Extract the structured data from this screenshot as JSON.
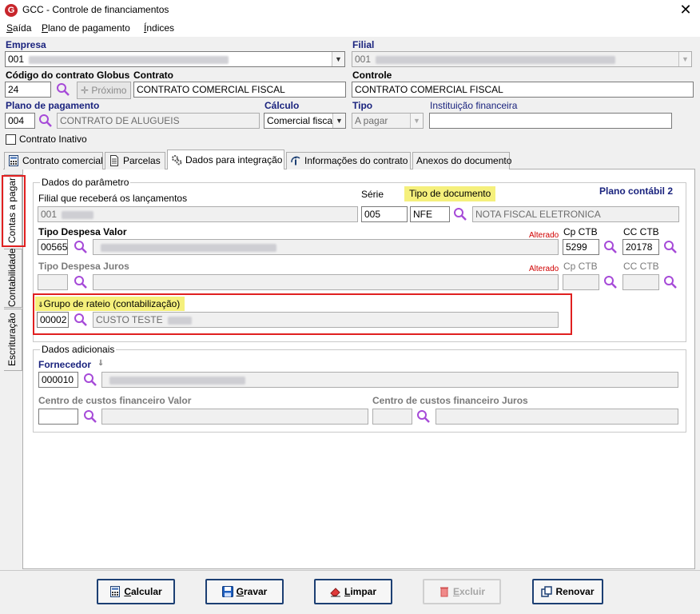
{
  "window": {
    "title": "GCC - Controle de financiamentos",
    "icon_letter": "G",
    "close_glyph": "✕"
  },
  "menu": [
    {
      "label": "Saída",
      "ul": "S",
      "rest": "aída"
    },
    {
      "label": "Plano de pagamento",
      "ul": "P",
      "rest": "lano de pagamento"
    },
    {
      "label": "Índices",
      "ul": "Í",
      "rest": "ndices"
    }
  ],
  "header": {
    "empresa": {
      "label": "Empresa",
      "value": "001"
    },
    "filial": {
      "label": "Filial",
      "value": "001"
    },
    "codigo_contrato": {
      "label": "Código do contrato Globus",
      "value": "24",
      "proximo_label": "Próximo"
    },
    "contrato": {
      "label": "Contrato",
      "value": "CONTRATO COMERCIAL FISCAL"
    },
    "controle": {
      "label": "Controle",
      "value": "CONTRATO COMERCIAL FISCAL"
    },
    "plano_pagamento": {
      "label": "Plano de pagamento",
      "code": "004",
      "desc": "CONTRATO DE ALUGUEIS"
    },
    "calculo": {
      "label": "Cálculo",
      "value": "Comercial fiscal"
    },
    "tipo": {
      "label": "Tipo",
      "value": "A pagar"
    },
    "instituicao": {
      "label": "Instituição financeira",
      "value": ""
    },
    "contrato_inativo": {
      "label": "Contrato Inativo",
      "checked": false
    }
  },
  "tabs": [
    {
      "label": "Contrato comercial",
      "icon": "calculator-icon"
    },
    {
      "label": "Parcelas",
      "icon": "document-icon"
    },
    {
      "label": "Dados para integração",
      "icon": "gears-icon",
      "active": true
    },
    {
      "label": "Informações do contrato",
      "icon": "info-icon"
    },
    {
      "label": "Anexos do documento",
      "icon": ""
    }
  ],
  "side_tabs": [
    {
      "label": "Contas a pagar",
      "active": true
    },
    {
      "label": "Contabilidade"
    },
    {
      "label": "Escrituração"
    }
  ],
  "dados_parametro": {
    "title": "Dados do parâmetro",
    "filial_lancamentos": {
      "label": "Filial que receberá os lançamentos",
      "value": "001"
    },
    "serie": {
      "label": "Série",
      "value": "005"
    },
    "tipo_documento": {
      "label": "Tipo de documento",
      "code": "NFE",
      "desc": "NOTA FISCAL ELETRONICA"
    },
    "plano_contabil": "Plano contábil 2",
    "tipo_despesa_valor": {
      "label": "Tipo Despesa Valor",
      "code": "00565",
      "alterado": "Alterado",
      "cp_ctb_label": "Cp CTB",
      "cp_ctb": "5299",
      "cc_ctb_label": "CC CTB",
      "cc_ctb": "20178"
    },
    "tipo_despesa_juros": {
      "label": "Tipo Despesa Juros",
      "code": "",
      "alterado": "Alterado",
      "cp_ctb_label": "Cp CTB",
      "cp_ctb": "",
      "cc_ctb_label": "CC CTB",
      "cc_ctb": ""
    },
    "grupo_rateio": {
      "label": "Grupo de rateio (contabilização)",
      "code": "00002",
      "desc": "CUSTO TESTE"
    }
  },
  "dados_adicionais": {
    "title": "Dados adicionais",
    "fornecedor": {
      "label": "Fornecedor",
      "code": "000010"
    },
    "cc_fin_valor": {
      "label": "Centro de custos financeiro Valor",
      "code": ""
    },
    "cc_fin_juros": {
      "label": "Centro de custos financeiro Juros",
      "code": ""
    }
  },
  "buttons": [
    {
      "label": "Calcular",
      "ul": "C",
      "rest": "alcular",
      "icon": "calculator-icon",
      "enabled": true
    },
    {
      "label": "Gravar",
      "ul": "G",
      "rest": "ravar",
      "icon": "save-icon",
      "enabled": true
    },
    {
      "label": "Limpar",
      "ul": "L",
      "rest": "impar",
      "icon": "eraser-icon",
      "enabled": true
    },
    {
      "label": "Excluir",
      "ul": "E",
      "rest": "xcluir",
      "icon": "trash-icon",
      "enabled": false
    },
    {
      "label": "Renovar",
      "ul": "",
      "rest": "Renovar",
      "icon": "renew-icon",
      "enabled": true
    }
  ],
  "colors": {
    "highlight": "#f5f07c",
    "alert_red": "#d00000",
    "magnifier": "#a64ad8",
    "button_border": "#1c3f73"
  }
}
